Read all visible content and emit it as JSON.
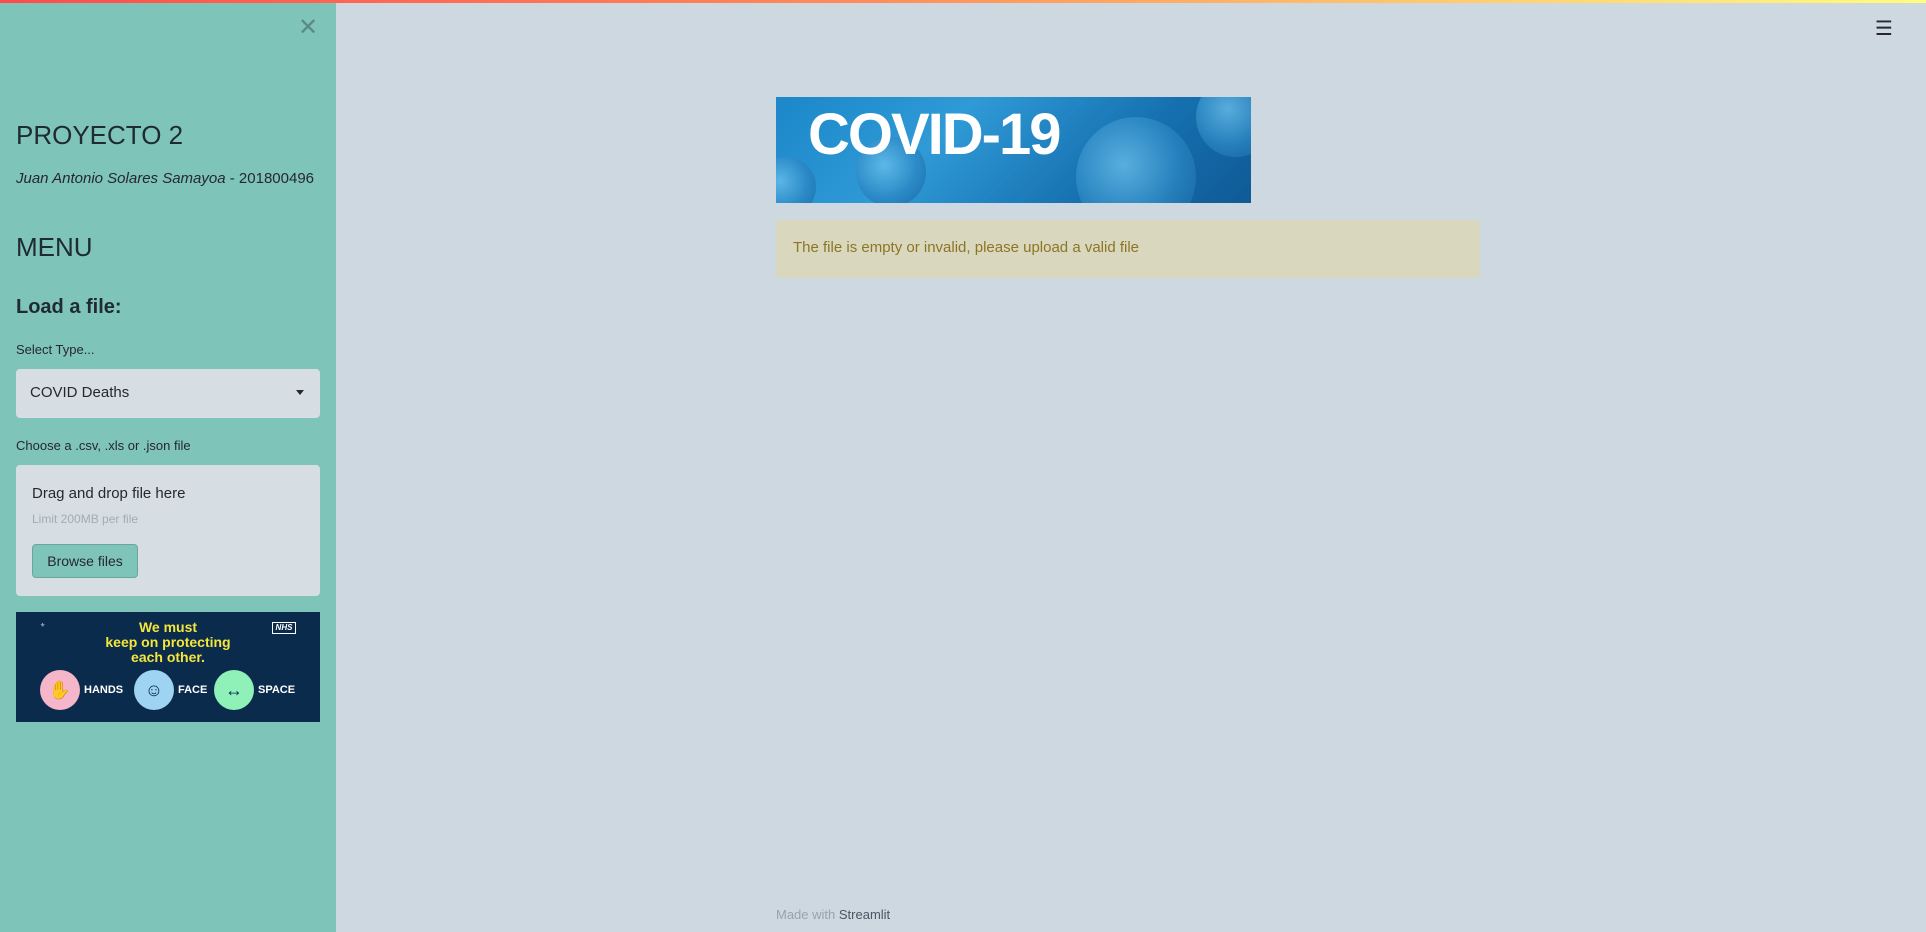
{
  "sidebar": {
    "close_icon": "✕",
    "title": "PROYECTO 2",
    "author_name": "Juan Antonio Solares Samayoa",
    "author_sep": " - ",
    "author_id": "201800496",
    "menu_heading": "MENU",
    "load_heading": "Load a file:",
    "select_label": "Select Type...",
    "select_value": "COVID Deaths",
    "file_label": "Choose a .csv, .xls or .json file",
    "uploader_title": "Drag and drop file here",
    "uploader_limit": "Limit 200MB per file",
    "browse_button": "Browse files",
    "ad": {
      "line1": "We must",
      "line2": "keep on protecting",
      "line3": "each other.",
      "nhs": "NHS",
      "items": [
        "HANDS",
        "FACE",
        "SPACE"
      ],
      "colors": {
        "hands": "#f4b6c8",
        "face": "#9fd3f2",
        "space": "#8ff0b8"
      }
    }
  },
  "main": {
    "menu_icon": "☰",
    "banner_text": "COVID-19",
    "alert_text": "The file is empty or invalid, please upload a valid file",
    "footer_prefix": "Made with ",
    "footer_link": "Streamlit"
  },
  "colors": {
    "sidebar_bg": "#7ec4b8",
    "main_bg": "#cdd8e0",
    "alert_bg": "#d9d8bf",
    "alert_text": "#8c7524"
  }
}
